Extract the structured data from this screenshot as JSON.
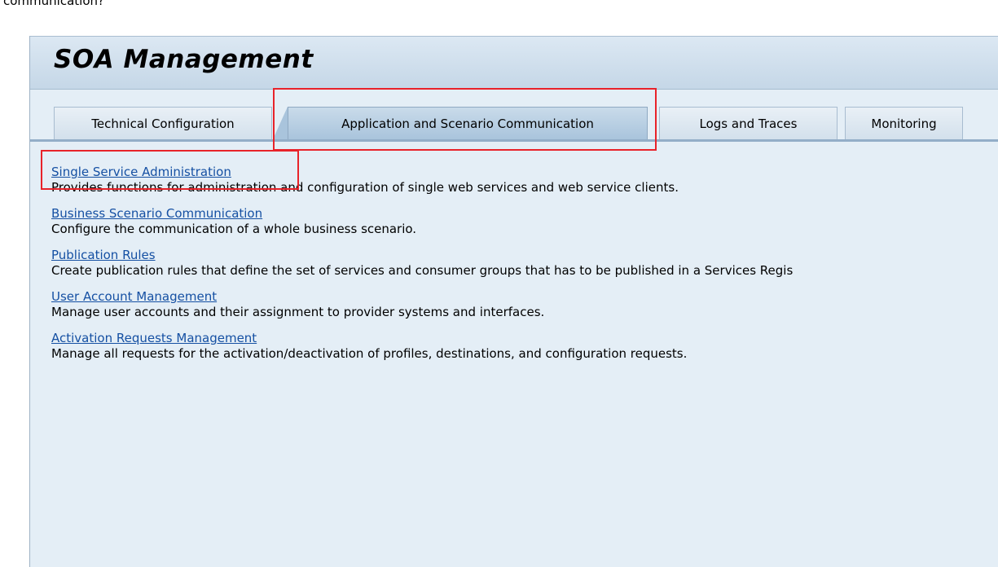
{
  "clipped_heading": "communication?",
  "header": {
    "title": "SOA Management"
  },
  "tabs": [
    {
      "label": "Technical Configuration",
      "active": false
    },
    {
      "label": "Application and Scenario Communication",
      "active": true
    },
    {
      "label": "Logs and Traces",
      "active": false
    },
    {
      "label": "Monitoring",
      "active": false
    }
  ],
  "entries": [
    {
      "link": "Single Service Administration",
      "description": "Provides functions for administration and configuration of single web services and web service clients."
    },
    {
      "link": "Business Scenario Communication",
      "description": "Configure the communication of a whole business scenario."
    },
    {
      "link": "Publication Rules",
      "description": "Create publication rules that define the set of services and consumer groups that has to be published in a Services Regis"
    },
    {
      "link": "User Account Management",
      "description": "Manage user accounts and their assignment to provider systems and interfaces."
    },
    {
      "link": "Activation Requests Management",
      "description": "Manage all requests for the activation/deactivation of profiles, destinations, and configuration requests."
    }
  ],
  "colors": {
    "link": "#1550a3",
    "highlight": "#e8232a",
    "panel_background": "#e4eef6",
    "active_tab": "#a9c4dc"
  }
}
